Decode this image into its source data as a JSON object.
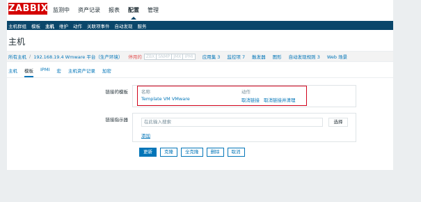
{
  "header": {
    "logo": "ZABBIX",
    "nav": [
      {
        "label": "监测中",
        "active": false
      },
      {
        "label": "资产记录",
        "active": false
      },
      {
        "label": "报表",
        "active": false
      },
      {
        "label": "配置",
        "active": true
      },
      {
        "label": "管理",
        "active": false
      }
    ]
  },
  "subnav": {
    "items": [
      {
        "label": "主机群组",
        "active": false
      },
      {
        "label": "模板",
        "active": false
      },
      {
        "label": "主机",
        "active": true
      },
      {
        "label": "维护",
        "active": false
      },
      {
        "label": "动作",
        "active": false
      },
      {
        "label": "关联项事件",
        "active": false
      },
      {
        "label": "自动发现",
        "active": false
      },
      {
        "label": "服务",
        "active": false
      }
    ]
  },
  "page": {
    "title": "主机"
  },
  "hostnav": {
    "all_hosts": "所有主机",
    "separator": "/",
    "host": "192.168.19.4 Wmware 平台（生产环境）",
    "status": "停用的",
    "badges": [
      "ZBX",
      "SNMP",
      "JMX",
      "IPMI"
    ],
    "links": [
      {
        "label": "应用集",
        "count": "3"
      },
      {
        "label": "监控项",
        "count": "7"
      },
      {
        "label": "触发器",
        "count": ""
      },
      {
        "label": "图形",
        "count": ""
      },
      {
        "label": "自动发现规则",
        "count": "3"
      },
      {
        "label": "Web 场景",
        "count": ""
      }
    ]
  },
  "tabs": [
    {
      "label": "主机",
      "active": false
    },
    {
      "label": "模板",
      "active": true
    },
    {
      "label": "IPMI",
      "active": false
    },
    {
      "label": "宏",
      "active": false
    },
    {
      "label": "主机资产记录",
      "active": false
    },
    {
      "label": "加密",
      "active": false
    }
  ],
  "form": {
    "linked_templates_label": "链接的模板",
    "table_headers": {
      "name": "名称",
      "action": "动作"
    },
    "template_row": {
      "name": "Template VM VMware",
      "unlink": "取消链接",
      "unlink_clear": "取消链接并清理"
    },
    "link_indicator_label": "链接指示器",
    "search_placeholder": "在此输入搜索",
    "select_label": "选择",
    "add_label": "添加"
  },
  "buttons": {
    "update": "更新",
    "clone": "克隆",
    "full_clone": "全克隆",
    "delete": "删除",
    "cancel": "取消"
  },
  "colors": {
    "brand": "#d40000",
    "nav_bg": "#0a466a",
    "link": "#0275b8",
    "highlight_border": "#d0021b",
    "disabled_red": "#e45959"
  }
}
